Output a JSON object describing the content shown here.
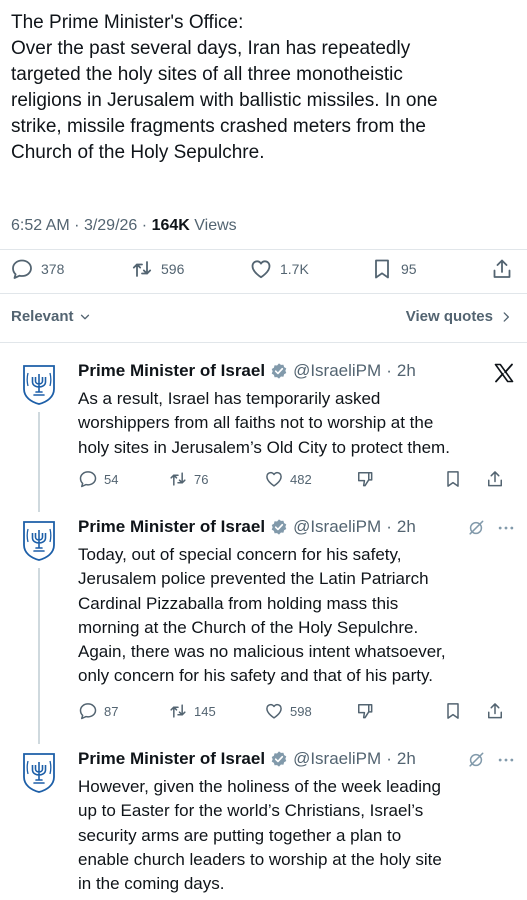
{
  "main_post": {
    "lines": [
      "The Prime Minister's Office:",
      "Over the past several days, Iran has repeatedly",
      "targeted the holy sites of all three monotheistic",
      "religions in Jerusalem with ballistic missiles. In one",
      "strike, missile fragments crashed meters from the",
      "Church of the Holy Sepulchre."
    ],
    "time": "6:52 AM",
    "date": "3/29/26",
    "views_count": "164K",
    "views_label": "Views",
    "sep": "·",
    "actions": {
      "replies": "378",
      "reposts": "596",
      "likes": "1.7K",
      "bookmarks": "95"
    }
  },
  "sort": {
    "label": "Relevant",
    "view_quotes": "View quotes"
  },
  "replies": [
    {
      "name": "Prime Minister of Israel",
      "handle": "@IsraeliPM",
      "time": "2h",
      "lines": [
        "As a result, Israel has temporarily asked",
        "worshippers from all faiths not to worship at the",
        "holy sites in Jerusalem’s Old City to protect them."
      ],
      "actions": {
        "replies": "54",
        "reposts": "76",
        "likes": "482"
      }
    },
    {
      "name": "Prime Minister of Israel",
      "handle": "@IsraeliPM",
      "time": "2h",
      "lines": [
        "Today, out of special concern for his safety,",
        "Jerusalem police prevented the Latin Patriarch",
        "Cardinal Pizzaballa from holding mass this",
        "morning at the Church of the Holy Sepulchre.",
        "Again, there was no malicious intent whatsoever,",
        "only concern for his safety and that of his party."
      ],
      "actions": {
        "replies": "87",
        "reposts": "145",
        "likes": "598"
      }
    },
    {
      "name": "Prime Minister of Israel",
      "handle": "@IsraeliPM",
      "time": "2h",
      "lines": [
        "However, given the holiness of the week leading",
        "up to Easter for the world’s Christians, Israel’s",
        "security arms are putting together a plan to",
        "enable church leaders to worship at the holy site",
        "in the coming days."
      ]
    }
  ],
  "colors": {
    "text": "#0f1419",
    "secondary": "#536471",
    "verified": "#829aab",
    "emblem": "#1d5fa8",
    "divider": "#e1e6ea"
  }
}
